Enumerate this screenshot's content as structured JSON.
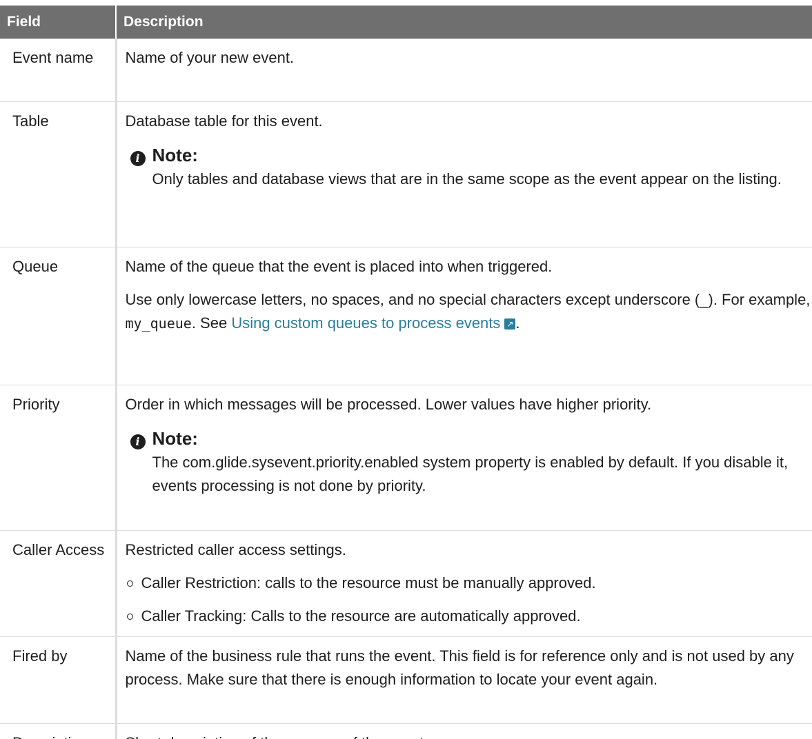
{
  "header": {
    "field": "Field",
    "description": "Description"
  },
  "rows": [
    {
      "field": "Event name",
      "description": "Name of your new event."
    },
    {
      "field": "Table",
      "description": "Database table for this event.",
      "note": {
        "title": "Note:",
        "text": "Only tables and database views that are in the same scope as the event appear on the listing."
      }
    },
    {
      "field": "Queue",
      "description": "Name of the queue that the event is placed into when triggered.",
      "p2_text": "Use only lowercase letters, no spaces, and no special characters except underscore (_). For example, ",
      "p2_code": "my_queue",
      "p2_after": ". See ",
      "link": "Using custom queues to process events",
      "p2_end": "."
    },
    {
      "field": "Priority",
      "description": "Order in which messages will be processed. Lower values have higher priority.",
      "note": {
        "title": "Note:",
        "text": "The com.glide.sysevent.priority.enabled system property is enabled by default. If you disable it, events processing is not done by priority."
      }
    },
    {
      "field": "Caller Access",
      "description": "Restricted caller access settings.",
      "bullets": [
        "Caller Restriction: calls to the resource must be manually approved.",
        "Caller Tracking: Calls to the resource are automatically approved."
      ]
    },
    {
      "field": "Fired by",
      "description": "Name of the business rule that runs the event. This field is for reference only and is not used by any process. Make sure that there is enough information to locate your event again."
    },
    {
      "field": "Description",
      "description": "Short description of the purpose of the event."
    }
  ],
  "icons": {
    "note": "info-icon",
    "external_link": "external-link-icon",
    "bullet": "hollow-circle-bullet-icon"
  },
  "colors": {
    "header_bg": "#6f6f6f",
    "link": "#2a7e9c",
    "border": "#dcdcdc"
  }
}
